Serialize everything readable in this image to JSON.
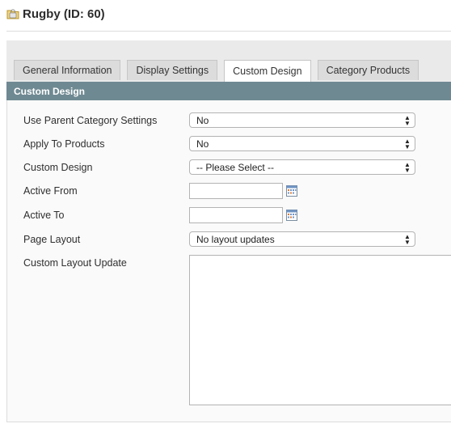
{
  "page": {
    "title": "Rugby (ID: 60)"
  },
  "tabs": [
    {
      "label": "General Information"
    },
    {
      "label": "Display Settings"
    },
    {
      "label": "Custom Design",
      "active": true
    },
    {
      "label": "Category Products"
    }
  ],
  "section": {
    "title": "Custom Design"
  },
  "form": {
    "use_parent": {
      "label": "Use Parent Category Settings",
      "value": "No"
    },
    "apply_to_products": {
      "label": "Apply To Products",
      "value": "No"
    },
    "custom_design": {
      "label": "Custom Design",
      "value": "-- Please Select --"
    },
    "active_from": {
      "label": "Active From",
      "value": ""
    },
    "active_to": {
      "label": "Active To",
      "value": ""
    },
    "page_layout": {
      "label": "Page Layout",
      "value": "No layout updates"
    },
    "custom_layout_update": {
      "label": "Custom Layout Update",
      "value": ""
    }
  },
  "colors": {
    "section_header_bg": "#6f8992",
    "tab_strip_bg": "#eaeaea",
    "form_bg": "#fafafa"
  },
  "icons": {
    "title": "folder-icon",
    "date_picker": "calendar-icon",
    "select": "select-arrows-icon"
  }
}
